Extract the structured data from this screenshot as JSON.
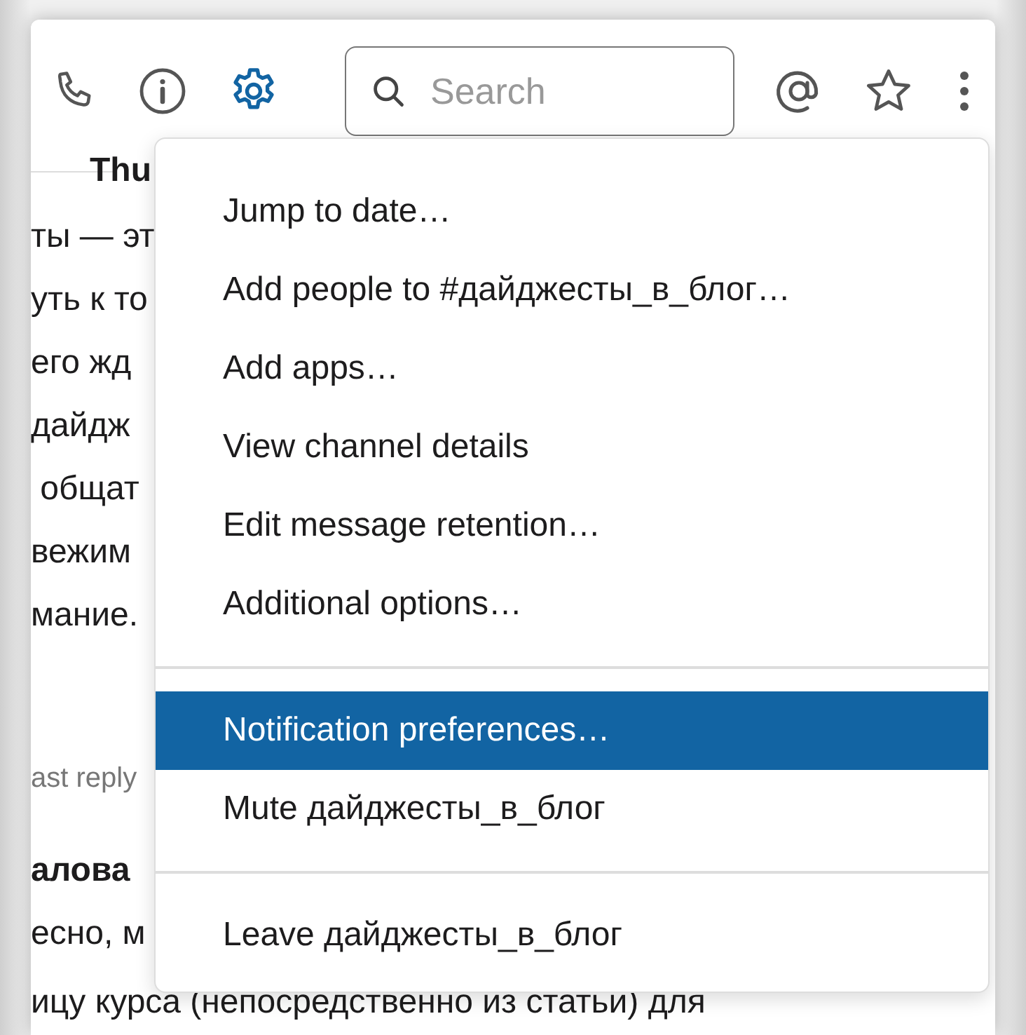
{
  "toolbar": {
    "icons": [
      {
        "kind": "phone",
        "selected": false
      },
      {
        "kind": "info",
        "selected": false
      },
      {
        "kind": "gear",
        "selected": true
      }
    ],
    "search": {
      "placeholder": "Search"
    },
    "right_icons": [
      {
        "kind": "at"
      },
      {
        "kind": "star"
      },
      {
        "kind": "more"
      }
    ]
  },
  "messages": {
    "date": "Thu",
    "lines": [
      {
        "kind": "text",
        "text": "ты — эт"
      },
      {
        "kind": "text",
        "text": "уть к то"
      },
      {
        "kind": "text",
        "text": "его жд"
      },
      {
        "kind": "text",
        "text": "дайдж"
      },
      {
        "kind": "text",
        "text": " общат"
      },
      {
        "kind": "text",
        "text": "вежим"
      },
      {
        "kind": "text",
        "text": "мание."
      },
      {
        "kind": "meta",
        "text": "ast reply"
      },
      {
        "kind": "author",
        "text": "алова"
      },
      {
        "kind": "text",
        "text": "есно, м"
      },
      {
        "kind": "text",
        "text": "ицу курса (непосредственно из статьи) для"
      }
    ]
  },
  "menu": {
    "sections": [
      [
        {
          "label": "Jump to date…",
          "selected": false
        },
        {
          "label": "Add people to #дайджесты_в_блог…",
          "selected": false
        },
        {
          "label": "Add apps…",
          "selected": false
        },
        {
          "label": "View channel details",
          "selected": false
        },
        {
          "label": "Edit message retention…",
          "selected": false
        },
        {
          "label": "Additional options…",
          "selected": false
        }
      ],
      [
        {
          "label": "Notification preferences…",
          "selected": true
        },
        {
          "label": "Mute дайджесты_в_блог",
          "selected": false
        }
      ],
      [
        {
          "label": "Leave дайджесты_в_блог",
          "selected": false
        }
      ]
    ]
  }
}
